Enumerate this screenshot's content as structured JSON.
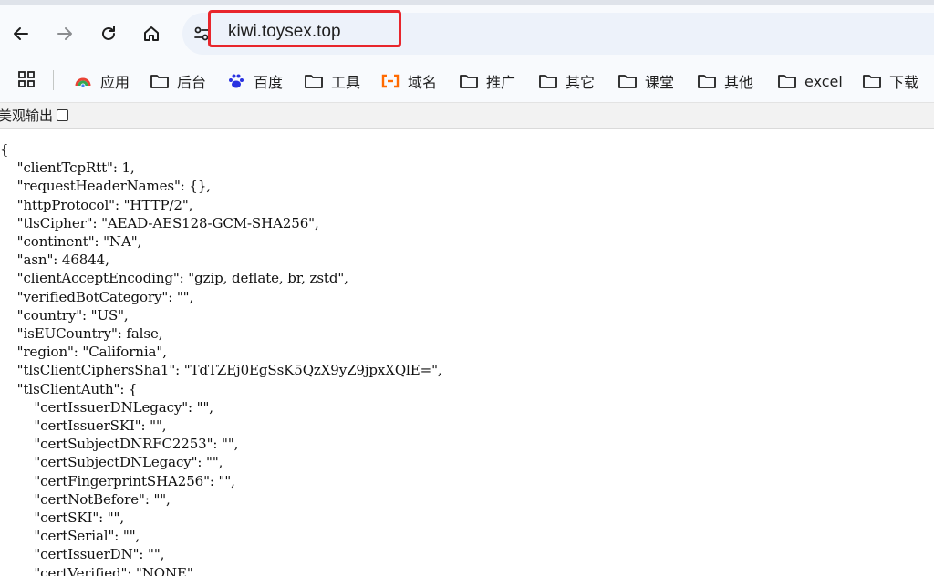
{
  "browser": {
    "url": "kiwi.toysex.top",
    "nav": {
      "back_icon": "arrow-left-icon",
      "forward_icon": "arrow-right-icon",
      "reload_icon": "reload-icon",
      "home_icon": "home-icon",
      "site_info_icon": "tune-icon"
    },
    "bookmarks": [
      {
        "label": "应用",
        "icon": "apps-color-icon"
      },
      {
        "label": "后台",
        "icon": "folder-icon"
      },
      {
        "label": "百度",
        "icon": "baidu-paw-icon"
      },
      {
        "label": "工具",
        "icon": "folder-icon"
      },
      {
        "label": "域名",
        "icon": "aliyun-icon"
      },
      {
        "label": "推广",
        "icon": "folder-icon"
      },
      {
        "label": "其它",
        "icon": "folder-icon"
      },
      {
        "label": "课堂",
        "icon": "folder-icon"
      },
      {
        "label": "其他",
        "icon": "folder-icon"
      },
      {
        "label": "excel",
        "icon": "folder-icon"
      },
      {
        "label": "下载",
        "icon": "folder-icon"
      }
    ],
    "accent_colors": {
      "highlight_border": "#e8262c",
      "aliyun": "#ff6a00",
      "baidu": "#2932e1"
    }
  },
  "viewer": {
    "pretty_print_label": "美观输出",
    "pretty_print_checked": false
  },
  "json_lines": [
    "{",
    "    \"clientTcpRtt\": 1,",
    "    \"requestHeaderNames\": {},",
    "    \"httpProtocol\": \"HTTP/2\",",
    "    \"tlsCipher\": \"AEAD-AES128-GCM-SHA256\",",
    "    \"continent\": \"NA\",",
    "    \"asn\": 46844,",
    "    \"clientAcceptEncoding\": \"gzip, deflate, br, zstd\",",
    "    \"verifiedBotCategory\": \"\",",
    "    \"country\": \"US\",",
    "    \"isEUCountry\": false,",
    "    \"region\": \"California\",",
    "    \"tlsClientCiphersSha1\": \"TdTZEj0EgSsK5QzX9yZ9jpxXQlE=\",",
    "    \"tlsClientAuth\": {",
    "        \"certIssuerDNLegacy\": \"\",",
    "        \"certIssuerSKI\": \"\",",
    "        \"certSubjectDNRFC2253\": \"\",",
    "        \"certSubjectDNLegacy\": \"\",",
    "        \"certFingerprintSHA256\": \"\",",
    "        \"certNotBefore\": \"\",",
    "        \"certSKI\": \"\",",
    "        \"certSerial\": \"\",",
    "        \"certIssuerDN\": \"\",",
    "        \"certVerified\": \"NONE\","
  ]
}
